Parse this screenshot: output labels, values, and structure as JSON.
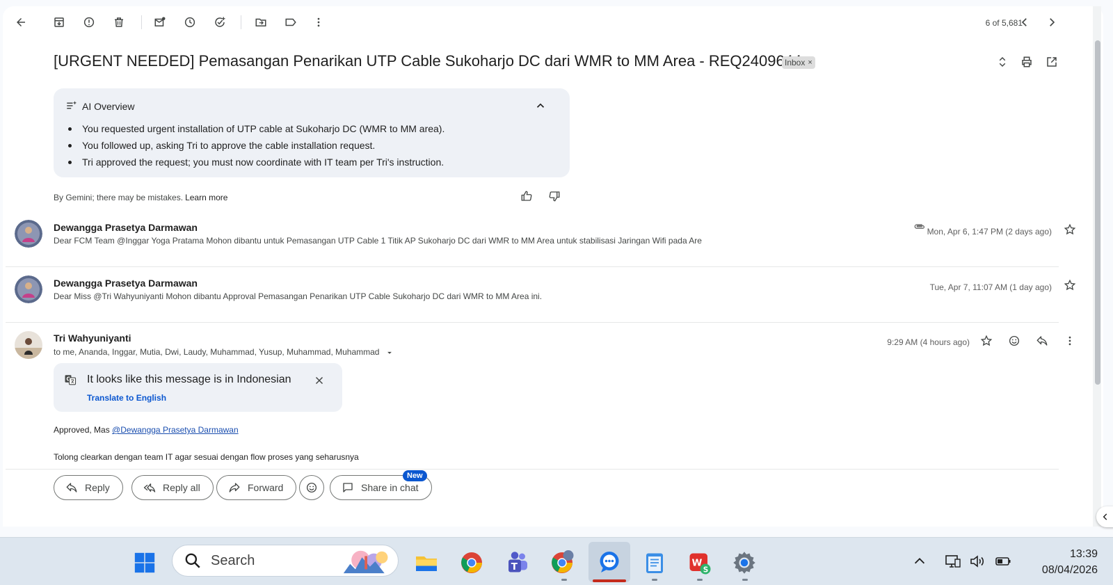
{
  "toolbar": {
    "page_count": "6 of 5,681"
  },
  "email": {
    "subject": "[URGENT NEEDED] Pemasangan Penarikan UTP Cable Sukoharjo DC dari WMR to MM Area - REQ2409644",
    "label_chip": "Inbox",
    "label_chip_close": "×"
  },
  "ai_overview": {
    "title": "AI Overview",
    "bullets": [
      "You requested urgent installation of UTP cable at Sukoharjo DC (WMR to MM area).",
      "You followed up, asking Tri to approve the cable installation request.",
      "Tri approved the request; you must now coordinate with IT team per Tri's instruction."
    ],
    "disclaimer": "By Gemini; there may be mistakes.",
    "learn_more": "Learn more"
  },
  "messages": [
    {
      "sender": "Dewangga Prasetya Darmawan",
      "snippet": "Dear FCM Team @Inggar Yoga Pratama Mohon dibantu untuk Pemasangan UTP Cable 1 Titik AP Sukoharjo DC dari WMR to MM Area untuk stabilisasi Jaringan Wifi pada Are",
      "date": "Mon, Apr 6, 1:47 PM (2 days ago)",
      "has_attachment": true
    },
    {
      "sender": "Dewangga Prasetya Darmawan",
      "snippet": "Dear Miss @Tri Wahyuniyanti Mohon dibantu Approval Pemasangan Penarikan UTP Cable Sukoharjo DC dari WMR to MM Area ini.",
      "date": "Tue, Apr 7, 11:07 AM (1 day ago)",
      "has_attachment": false
    },
    {
      "sender": "Tri Wahyuniyanti",
      "recipients": "to me, Ananda, Inggar, Mutia, Dwi, Laudy, Muhammad, Yusup, Muhammad, Muhammad",
      "date": "9:29 AM (4 hours ago)",
      "translate_title": "It looks like this message is in Indonesian",
      "translate_link": "Translate to English",
      "body_prefix": "Approved, Mas ",
      "body_mention": "@Dewangga Prasetya Darmawan",
      "body_line2": "Tolong clearkan dengan team IT agar sesuai dengan flow proses yang seharusnya"
    }
  ],
  "actions": {
    "reply": "Reply",
    "reply_all": "Reply all",
    "forward": "Forward",
    "share_in_chat": "Share in chat",
    "new_badge": "New"
  },
  "taskbar": {
    "search_placeholder": "Search",
    "time": "13:39",
    "date": "08/04/2026"
  },
  "colors": {
    "accent_blue": "#0b57d0",
    "ai_box_bg": "#eef1f6",
    "taskbar_bg": "#dde6ef",
    "red_indicator": "#c42b1c"
  }
}
